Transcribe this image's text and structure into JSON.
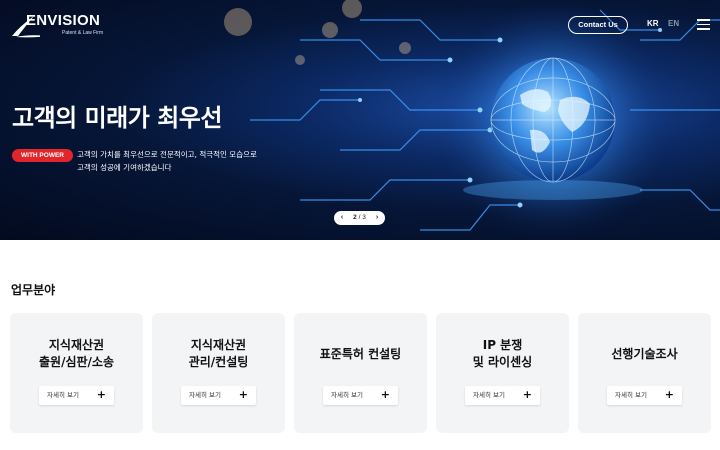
{
  "header": {
    "logo_text": "ENVISION",
    "logo_sub": "Patent & Law Firm",
    "contact_label": "Contact Us",
    "lang_kr": "KR",
    "lang_en": "EN",
    "menu_icon": "hamburger-menu-icon"
  },
  "hero": {
    "title": "고객의 미래가 최우선",
    "badge": "WITH POWER",
    "desc_line1": "고객의 가치를 최우선으로 전문적이고, 적극적인 모습으로",
    "desc_line2": "고객의 성공에 기여하겠습니다",
    "pager_current": "2",
    "pager_total": "3",
    "pager_prev": "‹",
    "pager_next": "›",
    "pager_sep": " / "
  },
  "practice": {
    "section_title": "업무분야",
    "cards": [
      {
        "line1": "지식재산권",
        "line2": "출원/심판/소송",
        "button": "자세히 보기"
      },
      {
        "line1": "지식재산권",
        "line2": "관리/컨설팅",
        "button": "자세히 보기"
      },
      {
        "line1": "표준특허 컨설팅",
        "line2": "",
        "button": "자세히 보기"
      },
      {
        "line1": "IP 분쟁",
        "line2": "및 라이센싱",
        "button": "자세히 보기"
      },
      {
        "line1": "선행기술조사",
        "line2": "",
        "button": "자세히 보기"
      }
    ],
    "plus_symbol": "+"
  },
  "colors": {
    "accent_red": "#e0262b",
    "hero_dark": "#061638",
    "card_bg": "#f3f4f6"
  }
}
